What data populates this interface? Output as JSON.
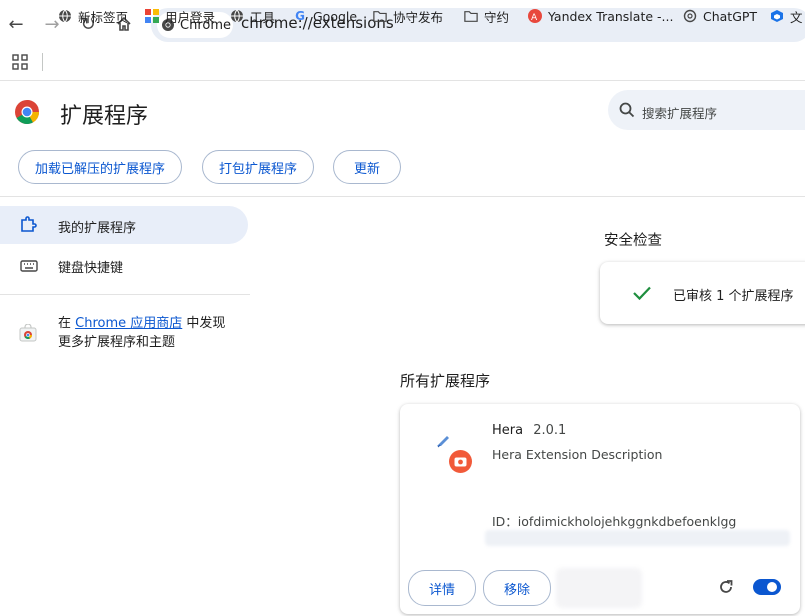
{
  "toolbar": {
    "chip_label": "Chrome",
    "url": "chrome://extensions"
  },
  "bookmarks": [
    {
      "label": "新标签页",
      "icon": "globe-icon"
    },
    {
      "label": "用户登录",
      "icon": "app-icon"
    },
    {
      "label": "工具",
      "icon": "globe-icon"
    },
    {
      "label": "Google",
      "icon": "google-icon"
    },
    {
      "label": "协守发布",
      "icon": "folder-icon"
    },
    {
      "label": "守约",
      "icon": "folder-icon"
    },
    {
      "label": "Yandex Translate -...",
      "icon": "yandex-icon"
    },
    {
      "label": "ChatGPT",
      "icon": "openai-icon"
    },
    {
      "label": "文",
      "icon": "cube-icon"
    }
  ],
  "header": {
    "title": "扩展程序",
    "search_placeholder": "搜索扩展程序"
  },
  "actions": {
    "load_unpacked": "加载已解压的扩展程序",
    "pack": "打包扩展程序",
    "update": "更新"
  },
  "sidebar": {
    "my_extensions": "我的扩展程序",
    "shortcuts": "键盘快捷键",
    "store_prefix": "在 ",
    "store_link": "Chrome 应用商店",
    "store_suffix": " 中发现",
    "store_line2": "更多扩展程序和主题"
  },
  "safety": {
    "heading": "安全检查",
    "status": "已审核 1 个扩展程序"
  },
  "all_extensions": {
    "heading": "所有扩展程序",
    "items": [
      {
        "name": "Hera",
        "version": "2.0.1",
        "description": "Hera Extension Description",
        "id": "ID：iofdimickholojehkggnkdbefoenklgg",
        "details_label": "详情",
        "remove_label": "移除",
        "enabled": true
      }
    ]
  },
  "colors": {
    "accent": "#0b57d0",
    "check": "#1e8e3e"
  }
}
